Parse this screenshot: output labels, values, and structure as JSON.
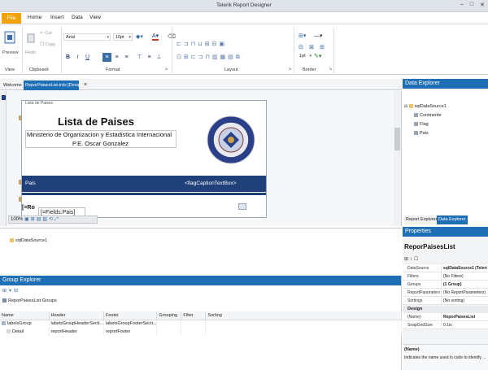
{
  "window": {
    "title": "Telerik Report Designer"
  },
  "menu": {
    "file": "File",
    "tabs": [
      "Home",
      "Insert",
      "Data",
      "View"
    ]
  },
  "ribbon": {
    "preview": "Preview",
    "redo": "Redo",
    "cut": "Cut",
    "copy": "Copy",
    "font_family": "Arial",
    "font_size": "10pt",
    "border_width": "1pt",
    "groups": {
      "view": "View",
      "clipboard": "Clipboard",
      "format": "Format",
      "layout": "Layout",
      "border": "Border"
    },
    "format_buttons": [
      "B",
      "I",
      "U"
    ]
  },
  "doc_tabs": {
    "welcome": "Welcome",
    "active": "ReporPaisesList.trdx [Design]",
    "close": "×"
  },
  "report": {
    "cut_text": "Lista de Paises",
    "title": "Lista de Paises",
    "subtitle1": "Ministerio de Organizacion y Estadistica Internacional",
    "subtitle2": "P.E. Oscar Gonzalez",
    "header_label": "Pais",
    "header_flag": "<flagCaptionTextBox>",
    "detail_expr1": "[=Ro",
    "detail_expr2": "[=Fields.Pais]",
    "zoom": "100%"
  },
  "tray": {
    "datasource": "sqlDataSource1"
  },
  "group_explorer": {
    "title": "Group Explorer",
    "root": "ReporPaisesList Groups",
    "columns": [
      "Name",
      "Header",
      "Footer",
      "Grouping",
      "Filter",
      "Sorting"
    ],
    "rows": [
      [
        "labelsGroup",
        "labelsGroupHeaderSecti...",
        "labelsGroupFooterSecti...",
        "",
        "",
        ""
      ],
      [
        "Detail",
        "reportHeader",
        "reportFooter",
        "",
        "",
        ""
      ]
    ]
  },
  "data_explorer": {
    "title": "Data Explorer",
    "source": "sqlDataSource1",
    "fields": [
      "Continente",
      "Flag",
      "Pais"
    ],
    "tabs": [
      "Report Explorer",
      "Data Explorer"
    ]
  },
  "properties": {
    "title": "Properties",
    "object": "ReporPaisesList",
    "rows": [
      {
        "k": "DataSource",
        "v": "sqlDataSource1 (Teleri"
      },
      {
        "k": "Filters",
        "v": "(No Filters)"
      },
      {
        "k": "Groups",
        "v": "(1 Group)"
      },
      {
        "k": "ReportParameters",
        "v": "(No ReportParameters)"
      },
      {
        "k": "Sortings",
        "v": "(No sorting)"
      }
    ],
    "design_cat": "Design",
    "design_rows": [
      {
        "k": "(Name)",
        "v": "ReporPaisesList"
      },
      {
        "k": "SnapGridSize",
        "v": "0.1in"
      }
    ],
    "help_title": "(Name)",
    "help_text": "Indicates the name used in code to identify ..."
  },
  "colors": {
    "accent": "#1e6fb5",
    "band": "#20407a",
    "file": "#f0a30a"
  }
}
